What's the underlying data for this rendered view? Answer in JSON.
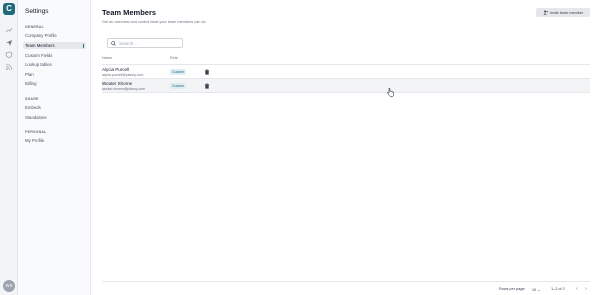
{
  "rail": {
    "logo_letter": "C",
    "icons": [
      "chart-icon",
      "send-icon",
      "shield-icon",
      "rss-icon"
    ],
    "avatar_initials": "WS"
  },
  "sidebar": {
    "title": "Settings",
    "sections": [
      {
        "label": "GENERAL",
        "items": [
          "Company Profile",
          "Team Members",
          "Custom Fields",
          "Lookup tables",
          "Plan",
          "Billing"
        ]
      },
      {
        "label": "SHARE",
        "items": [
          "Embeds",
          "Standalone"
        ]
      },
      {
        "label": "PERSONAL",
        "items": [
          "My Profile"
        ]
      }
    ],
    "active_item": "Team Members"
  },
  "header": {
    "title": "Team Members",
    "subtitle": "Get an overview and control what your team members can do",
    "invite_label": "Invite team member"
  },
  "search": {
    "placeholder": "Search...",
    "value": ""
  },
  "table": {
    "columns": [
      "Name",
      "Role"
    ],
    "rows": [
      {
        "name": "Alycia Purcell",
        "email": "alycia.purcell@planny.com",
        "role": "Custom"
      },
      {
        "name": "Wouter Shorne",
        "email": "wouter.shorne@planny.com",
        "role": "Custom"
      }
    ]
  },
  "footer": {
    "rows_per_page_label": "Rows per page:",
    "rows_per_page_value": "10",
    "range": "1–2 of 2"
  }
}
